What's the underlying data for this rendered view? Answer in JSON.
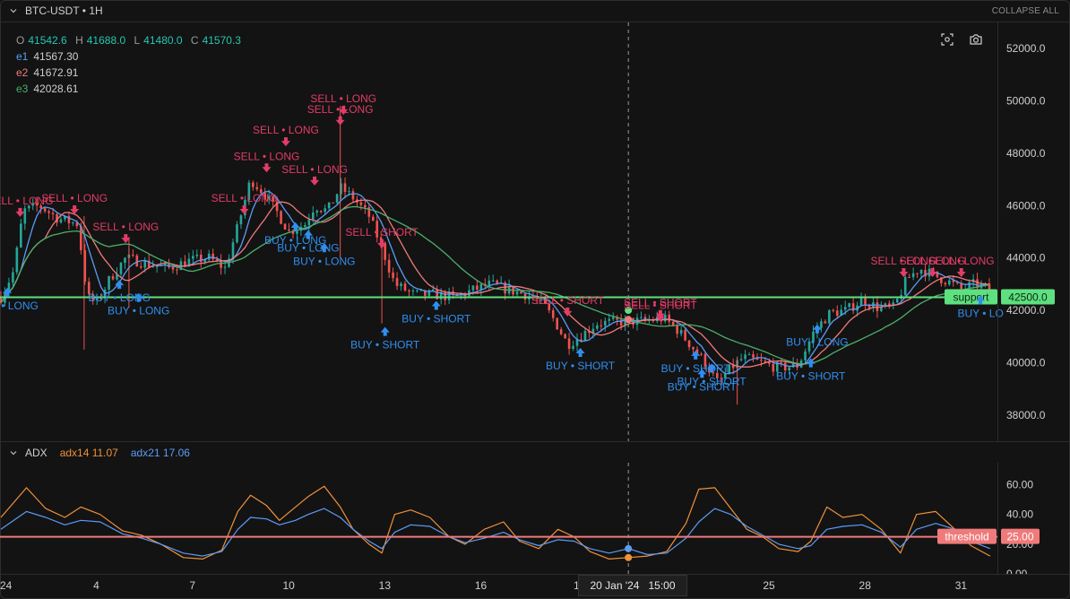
{
  "symbol_header": {
    "title": "BTC-USDT • 1H",
    "collapse_label": "COLLAPSE ALL"
  },
  "price_legend": {
    "ohlc": [
      {
        "key": "O",
        "value": "41542.6"
      },
      {
        "key": "H",
        "value": "41688.0"
      },
      {
        "key": "L",
        "value": "41480.0"
      },
      {
        "key": "C",
        "value": "41570.3"
      }
    ],
    "emas": [
      {
        "key": "e1",
        "value": "41567.30",
        "color": "#5b9cf6"
      },
      {
        "key": "e2",
        "value": "41672.91",
        "color": "#f07a7a"
      },
      {
        "key": "e3",
        "value": "42028.61",
        "color": "#4caf6a"
      }
    ]
  },
  "toolbar_icons": [
    "screenshot-region-icon",
    "camera-icon"
  ],
  "adx_header": {
    "title": "ADX",
    "adx14_label": "adx14 11.07",
    "adx21_label": "adx21 17.06",
    "adx14_color": "#f0913a",
    "adx21_color": "#5b9cf6"
  },
  "colors": {
    "up": "#26a69a",
    "down": "#ef5350",
    "sell": "#e23c67",
    "buy": "#2f8ff0",
    "support": "#5ee07f",
    "threshold": "#f07a7a"
  },
  "crosshair": {
    "date": "20 Jan '24",
    "time": "15:00",
    "x_day": 20.6
  },
  "x_axis": {
    "ticks": [
      {
        "day": 1,
        "label": "24"
      },
      {
        "day": 4,
        "label": "4"
      },
      {
        "day": 7,
        "label": "7"
      },
      {
        "day": 10,
        "label": "10"
      },
      {
        "day": 13,
        "label": "13"
      },
      {
        "day": 16,
        "label": "16"
      },
      {
        "day": 19,
        "label": "1"
      },
      {
        "day": 25,
        "label": "25"
      },
      {
        "day": 28,
        "label": "28"
      },
      {
        "day": 31,
        "label": "31"
      }
    ]
  },
  "chart_data": [
    {
      "type": "candlestick",
      "title": "BTC-USDT • 1H",
      "y_ticks": [
        "52000.0",
        "50000.0",
        "48000.0",
        "46000.0",
        "44000.0",
        "42000.0",
        "40000.0",
        "38000.0"
      ],
      "ylim": [
        37000,
        53000
      ],
      "xlim_days": [
        1,
        32.1
      ],
      "close_path": [
        [
          1.0,
          42500
        ],
        [
          1.4,
          43500
        ],
        [
          1.7,
          45800
        ],
        [
          2.2,
          46000
        ],
        [
          2.8,
          45500
        ],
        [
          3.4,
          45300
        ],
        [
          3.7,
          42500
        ],
        [
          4.0,
          42300
        ],
        [
          4.4,
          43200
        ],
        [
          4.9,
          44000
        ],
        [
          5.5,
          43800
        ],
        [
          6.2,
          43600
        ],
        [
          6.9,
          43900
        ],
        [
          7.5,
          44000
        ],
        [
          8.0,
          43600
        ],
        [
          8.4,
          45200
        ],
        [
          8.8,
          47000
        ],
        [
          9.2,
          46500
        ],
        [
          9.6,
          45800
        ],
        [
          10.0,
          45000
        ],
        [
          10.5,
          45300
        ],
        [
          10.8,
          46000
        ],
        [
          11.2,
          45800
        ],
        [
          11.6,
          46700
        ],
        [
          12.0,
          46300
        ],
        [
          12.5,
          45600
        ],
        [
          12.9,
          44400
        ],
        [
          13.3,
          43000
        ],
        [
          13.9,
          42600
        ],
        [
          14.5,
          42600
        ],
        [
          15.2,
          42500
        ],
        [
          15.8,
          42800
        ],
        [
          16.3,
          43000
        ],
        [
          16.8,
          42800
        ],
        [
          17.4,
          42600
        ],
        [
          17.9,
          42300
        ],
        [
          18.3,
          41600
        ],
        [
          18.7,
          40700
        ],
        [
          19.1,
          41000
        ],
        [
          19.6,
          41500
        ],
        [
          20.2,
          41550
        ],
        [
          20.6,
          41570
        ],
        [
          21.2,
          41600
        ],
        [
          21.7,
          41700
        ],
        [
          22.1,
          41300
        ],
        [
          22.6,
          40600
        ],
        [
          23.0,
          40000
        ],
        [
          23.4,
          39200
        ],
        [
          23.8,
          39800
        ],
        [
          24.2,
          40200
        ],
        [
          24.7,
          40000
        ],
        [
          25.3,
          39800
        ],
        [
          25.9,
          39900
        ],
        [
          26.4,
          41200
        ],
        [
          26.9,
          41900
        ],
        [
          27.4,
          42000
        ],
        [
          27.9,
          42400
        ],
        [
          28.4,
          42100
        ],
        [
          28.9,
          42100
        ],
        [
          29.3,
          43200
        ],
        [
          29.7,
          43600
        ],
        [
          30.2,
          43300
        ],
        [
          30.6,
          43100
        ],
        [
          31.0,
          42800
        ],
        [
          31.4,
          43000
        ],
        [
          31.9,
          42800
        ]
      ],
      "series": [
        {
          "name": "e1",
          "color": "#5b9cf6",
          "window": 6
        },
        {
          "name": "e2",
          "color": "#f07a7a",
          "window": 12
        },
        {
          "name": "e3",
          "color": "#4caf6a",
          "window": 28
        }
      ],
      "annotations": [
        {
          "day": 1.6,
          "price": 45500,
          "kind": "sell",
          "label": "SELL • LONG"
        },
        {
          "day": 3.3,
          "price": 45600,
          "kind": "sell",
          "label": "SELL • LONG"
        },
        {
          "day": 4.9,
          "price": 44500,
          "kind": "sell",
          "label": "SELL • LONG"
        },
        {
          "day": 8.6,
          "price": 45600,
          "kind": "sell",
          "label": "SELL • LONG"
        },
        {
          "day": 9.3,
          "price": 47200,
          "kind": "sell",
          "label": "SELL • LONG"
        },
        {
          "day": 9.9,
          "price": 48200,
          "kind": "sell",
          "label": "SELL • LONG"
        },
        {
          "day": 10.8,
          "price": 46700,
          "kind": "sell",
          "label": "SELL • LONG"
        },
        {
          "day": 11.6,
          "price": 49000,
          "kind": "sell",
          "label": "SELL • LONG"
        },
        {
          "day": 11.7,
          "price": 49400,
          "kind": "sell",
          "label": "SELL • LONG"
        },
        {
          "day": 12.9,
          "price": 44300,
          "kind": "sell",
          "label": "SELL • SHORT"
        },
        {
          "day": 18.7,
          "price": 41700,
          "kind": "sell",
          "label": "SELL • SHORT"
        },
        {
          "day": 21.6,
          "price": 41600,
          "kind": "sell",
          "label": "SELL • SHORT"
        },
        {
          "day": 21.6,
          "price": 41500,
          "kind": "sell",
          "label": "SELL • SHORT"
        },
        {
          "day": 29.2,
          "price": 43200,
          "kind": "sell",
          "label": "SELL • LONG"
        },
        {
          "day": 30.1,
          "price": 43200,
          "kind": "sell",
          "label": "SELL • LONG"
        },
        {
          "day": 31.0,
          "price": 43200,
          "kind": "sell",
          "label": "SELL • LONG"
        },
        {
          "day": 1.2,
          "price": 43000,
          "kind": "buy",
          "label": "BUY • LONG"
        },
        {
          "day": 4.7,
          "price": 43300,
          "kind": "buy",
          "label": "BUY • LONG"
        },
        {
          "day": 5.3,
          "price": 42800,
          "kind": "buy",
          "label": "BUY • LONG"
        },
        {
          "day": 10.2,
          "price": 45500,
          "kind": "buy",
          "label": "BUY • LONG"
        },
        {
          "day": 10.6,
          "price": 45200,
          "kind": "buy",
          "label": "BUY • LONG"
        },
        {
          "day": 11.1,
          "price": 44700,
          "kind": "buy",
          "label": "BUY • LONG"
        },
        {
          "day": 13.0,
          "price": 41500,
          "kind": "buy",
          "label": "BUY • SHORT"
        },
        {
          "day": 14.6,
          "price": 42500,
          "kind": "buy",
          "label": "BUY • SHORT"
        },
        {
          "day": 19.1,
          "price": 40700,
          "kind": "buy",
          "label": "BUY • SHORT"
        },
        {
          "day": 22.7,
          "price": 40600,
          "kind": "buy",
          "label": "BUY • SHORT"
        },
        {
          "day": 23.2,
          "price": 40100,
          "kind": "buy",
          "label": "BUY • SHORT"
        },
        {
          "day": 22.9,
          "price": 39900,
          "kind": "buy",
          "label": "BUY • SHORT"
        },
        {
          "day": 26.3,
          "price": 40300,
          "kind": "buy",
          "label": "BUY • SHORT"
        },
        {
          "day": 26.5,
          "price": 41600,
          "kind": "buy",
          "label": "BUY • LONG"
        },
        {
          "day": 31.6,
          "price": 42700,
          "kind": "buy",
          "label": "BUY • LO"
        }
      ],
      "support": {
        "price": 42500,
        "label": "support",
        "value_label": "42500.0"
      },
      "markers": [
        {
          "day": 20.6,
          "price": 42000,
          "color": "#5ee07f"
        },
        {
          "day": 20.6,
          "price": 41650,
          "color": "#f07a7a"
        }
      ]
    },
    {
      "type": "line",
      "title": "ADX",
      "y_ticks": [
        "60.00",
        "40.00",
        "20.00",
        "0.00"
      ],
      "ylim": [
        0,
        70
      ],
      "xlim_days": [
        1,
        32.1
      ],
      "series": [
        {
          "name": "adx14",
          "color": "#f0913a",
          "x": [
            1.0,
            1.8,
            2.4,
            3.0,
            3.5,
            4.1,
            4.8,
            5.4,
            6.0,
            6.7,
            7.3,
            7.9,
            8.4,
            8.8,
            9.3,
            9.7,
            10.2,
            10.6,
            11.1,
            11.6,
            12.0,
            12.5,
            12.9,
            13.3,
            13.8,
            14.4,
            15.0,
            15.5,
            16.1,
            16.7,
            17.2,
            17.8,
            18.4,
            18.9,
            19.4,
            20.0,
            20.6,
            21.2,
            21.8,
            22.4,
            22.8,
            23.3,
            23.8,
            24.3,
            24.8,
            25.3,
            25.9,
            26.3,
            26.8,
            27.3,
            27.9,
            28.5,
            29.1,
            29.6,
            30.2,
            30.8,
            31.3,
            31.9
          ],
          "values": [
            38,
            58,
            44,
            38,
            45,
            40,
            29,
            26,
            20,
            11,
            10,
            16,
            42,
            53,
            46,
            36,
            45,
            52,
            59,
            45,
            30,
            20,
            14,
            40,
            43,
            38,
            25,
            20,
            30,
            35,
            22,
            17,
            30,
            25,
            15,
            10,
            11,
            12,
            15,
            34,
            57,
            58,
            44,
            30,
            25,
            17,
            15,
            22,
            45,
            38,
            40,
            30,
            14,
            40,
            42,
            30,
            19,
            12
          ]
        },
        {
          "name": "adx21",
          "color": "#5b9cf6",
          "x": [
            1.0,
            1.8,
            2.4,
            3.0,
            3.5,
            4.1,
            4.8,
            5.4,
            6.0,
            6.7,
            7.3,
            7.9,
            8.4,
            8.8,
            9.3,
            9.7,
            10.2,
            10.6,
            11.1,
            11.6,
            12.0,
            12.5,
            12.9,
            13.3,
            13.8,
            14.4,
            15.0,
            15.5,
            16.1,
            16.7,
            17.2,
            17.8,
            18.4,
            18.9,
            19.4,
            20.0,
            20.6,
            21.2,
            21.8,
            22.4,
            22.8,
            23.3,
            23.8,
            24.3,
            24.8,
            25.3,
            25.9,
            26.3,
            26.8,
            27.3,
            27.9,
            28.5,
            29.1,
            29.6,
            30.2,
            30.8,
            31.3,
            31.9
          ],
          "values": [
            30,
            42,
            38,
            33,
            36,
            35,
            27,
            24,
            20,
            14,
            12,
            15,
            30,
            38,
            37,
            33,
            36,
            40,
            44,
            38,
            30,
            22,
            17,
            28,
            33,
            32,
            25,
            21,
            24,
            28,
            23,
            19,
            23,
            22,
            17,
            14,
            17,
            13,
            14,
            24,
            35,
            44,
            40,
            32,
            26,
            20,
            17,
            19,
            30,
            32,
            33,
            28,
            18,
            30,
            34,
            30,
            22,
            17
          ]
        }
      ],
      "threshold": {
        "value": 25,
        "label": "threshold",
        "value_label": "25.00"
      },
      "markers": [
        {
          "day": 20.6,
          "value": 17,
          "color": "#5b9cf6"
        },
        {
          "day": 20.6,
          "value": 11,
          "color": "#f0913a"
        }
      ]
    }
  ]
}
